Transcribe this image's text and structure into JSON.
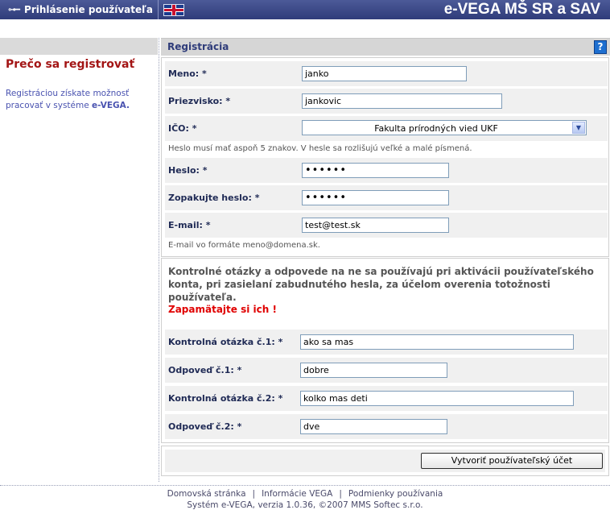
{
  "topbar": {
    "login_label": "Prihlásenie používateľa",
    "brand": "e-VEGA MŠ SR a SAV"
  },
  "left": {
    "title": "Prečo sa registrovať",
    "text_prefix": "Registráciou získate možnosť pracovať v systéme ",
    "text_bold": "e-VEGA."
  },
  "main": {
    "title": "Registrácia",
    "help_label": "?"
  },
  "form": {
    "meno": {
      "label": "Meno:  *",
      "value": "janko"
    },
    "priezvisko": {
      "label": "Priezvisko:  *",
      "value": "jankovic"
    },
    "ico": {
      "label": "IČO:  *",
      "value": "Fakulta prírodných vied UKF"
    },
    "password_note": "Heslo musí mať aspoň 5 znakov. V hesle sa rozlišujú veľké a malé písmená.",
    "heslo": {
      "label": "Heslo:  *",
      "value": "••••••"
    },
    "zopakujte": {
      "label": "Zopakujte heslo: *",
      "value": "••••••"
    },
    "email": {
      "label": "E-mail:  *",
      "value": "test@test.sk"
    },
    "email_note": "E-mail vo formáte meno@domena.sk."
  },
  "questions": {
    "info": "Kontrolné otázky a odpovede na ne sa používajú pri aktivácii používateľského konta, pri zasielaní zabudnutého hesla, za účelom overenia totožnosti používateľa.",
    "warning": "Zapamätajte si ich !",
    "q1": {
      "label": "Kontrolná otázka č.1:  *",
      "value": "ako sa mas"
    },
    "a1": {
      "label": "Odpoveď č.1:  *",
      "value": "dobre"
    },
    "q2": {
      "label": "Kontrolná otázka č.2:  *",
      "value": "kolko mas deti"
    },
    "a2": {
      "label": "Odpoveď č.2:  *",
      "value": "dve"
    }
  },
  "submit_label": "Vytvoriť používateľský účet",
  "footer": {
    "links": [
      "Domovská stránka",
      "Informácie VEGA",
      "Podmienky používania"
    ],
    "separator": "|",
    "copyright": "Systém e-VEGA, verzia 1.0.36, ©2007 MMS Softec s.r.o."
  }
}
